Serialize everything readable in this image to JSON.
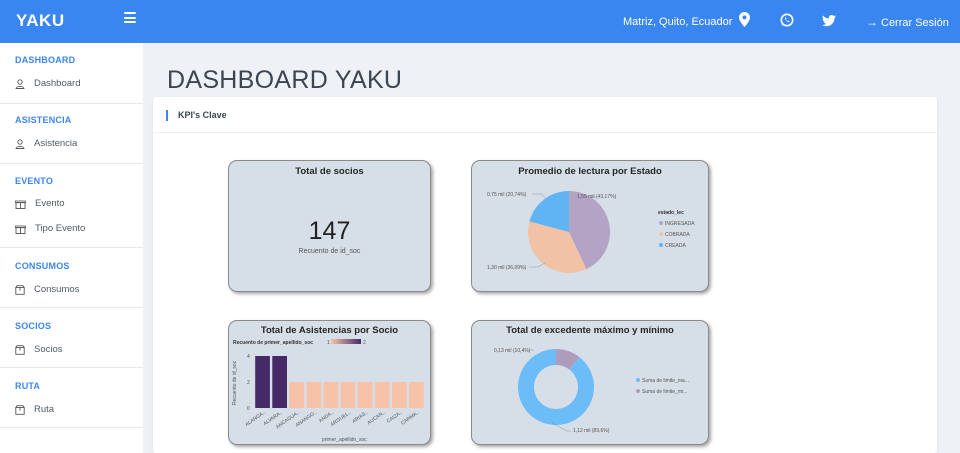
{
  "topbar": {
    "brand": "YAKU",
    "location": "Matriz, Quito, Ecuador",
    "logout_label": "Cerrar Sesión"
  },
  "icons": {
    "menu": "hamburger-icon",
    "location": "map-pin-icon",
    "whatsapp": "whatsapp-icon",
    "twitter": "twitter-icon",
    "logout": "arrow-right-icon"
  },
  "sidebar": {
    "sections": [
      {
        "title": "DASHBOARD",
        "items": [
          {
            "label": "Dashboard",
            "icon": "user-icon"
          }
        ]
      },
      {
        "title": "ASISTENCIA",
        "items": [
          {
            "label": "Asistencia",
            "icon": "user-icon"
          }
        ]
      },
      {
        "title": "EVENTO",
        "items": [
          {
            "label": "Evento",
            "icon": "gift-icon"
          },
          {
            "label": "Tipo Evento",
            "icon": "gift-icon"
          }
        ]
      },
      {
        "title": "CONSUMOS",
        "items": [
          {
            "label": "Consumos",
            "icon": "box-icon"
          }
        ]
      },
      {
        "title": "SOCIOS",
        "items": [
          {
            "label": "Socios",
            "icon": "box-icon"
          }
        ]
      },
      {
        "title": "RUTA",
        "items": [
          {
            "label": "Ruta",
            "icon": "box-icon"
          }
        ]
      }
    ]
  },
  "main": {
    "title": "DASHBOARD YAKU",
    "card_title": "KPI's Clave"
  },
  "kpi": {
    "title": "Total de socios",
    "value": "147",
    "label": "Recuento de id_soc"
  },
  "colors": {
    "accent": "#3a86f0",
    "pie_ingresada": "#b4a3c4",
    "pie_cobrada": "#f2c2a6",
    "pie_creada": "#61b4f4",
    "bar_dark": "#452a67",
    "bar_light": "#f6c3a8",
    "donut_main": "#6cbcf8",
    "donut_minor": "#ad9cbc"
  },
  "chart_data": [
    {
      "type": "pie",
      "title": "Promedio de lectura por Estado",
      "legend_title": "estado_lec",
      "legend_position": "right",
      "categories": [
        "INGRESADA",
        "COBRADA",
        "CREADA"
      ],
      "values": [
        1.55,
        1.3,
        0.75
      ],
      "labels": [
        "1,55 mil (43,17%)",
        "1,30 mil (36,09%)",
        "0,75 mil (20,74%)"
      ]
    },
    {
      "type": "bar",
      "title": "Total de Asistencias por Socio",
      "legend_title": "Recuento de primer_apellido_soc",
      "legend_min": "1",
      "legend_max": "2",
      "xlabel": "primer_apellido_soc",
      "ylabel": "Recuento de id_soc",
      "ylim": [
        0,
        4
      ],
      "yticks": [
        "0",
        "2",
        "4"
      ],
      "categories": [
        "ALANGA...",
        "ALVARA...",
        "ANCAGUA...",
        "ANANGO...",
        "ANDA...",
        "ARGUEL...",
        "ARIAS...",
        "AUCAN...",
        "CAIZA...",
        "CAIZA..."
      ],
      "category_labels": [
        "ALANGA..",
        "ALVARA..",
        "ANCAGUA..",
        "ANANGO..",
        "ANDA..",
        "ARGUEL..",
        "ARIAS..",
        "AUCAN..",
        "CAIZA..",
        "CARMA.."
      ],
      "values": [
        4,
        4,
        2,
        2,
        2,
        2,
        2,
        2,
        2,
        2
      ]
    },
    {
      "type": "pie",
      "subtype": "donut",
      "title": "Total de excedente máximo y mínimo",
      "legend_position": "right",
      "categories": [
        "Suma de limite_ma...",
        "Suma de limite_mi..."
      ],
      "values": [
        1.12,
        0.13
      ],
      "labels": [
        "1,12 mil (89,6%)",
        "0,13 mil (10,4%)"
      ]
    }
  ]
}
